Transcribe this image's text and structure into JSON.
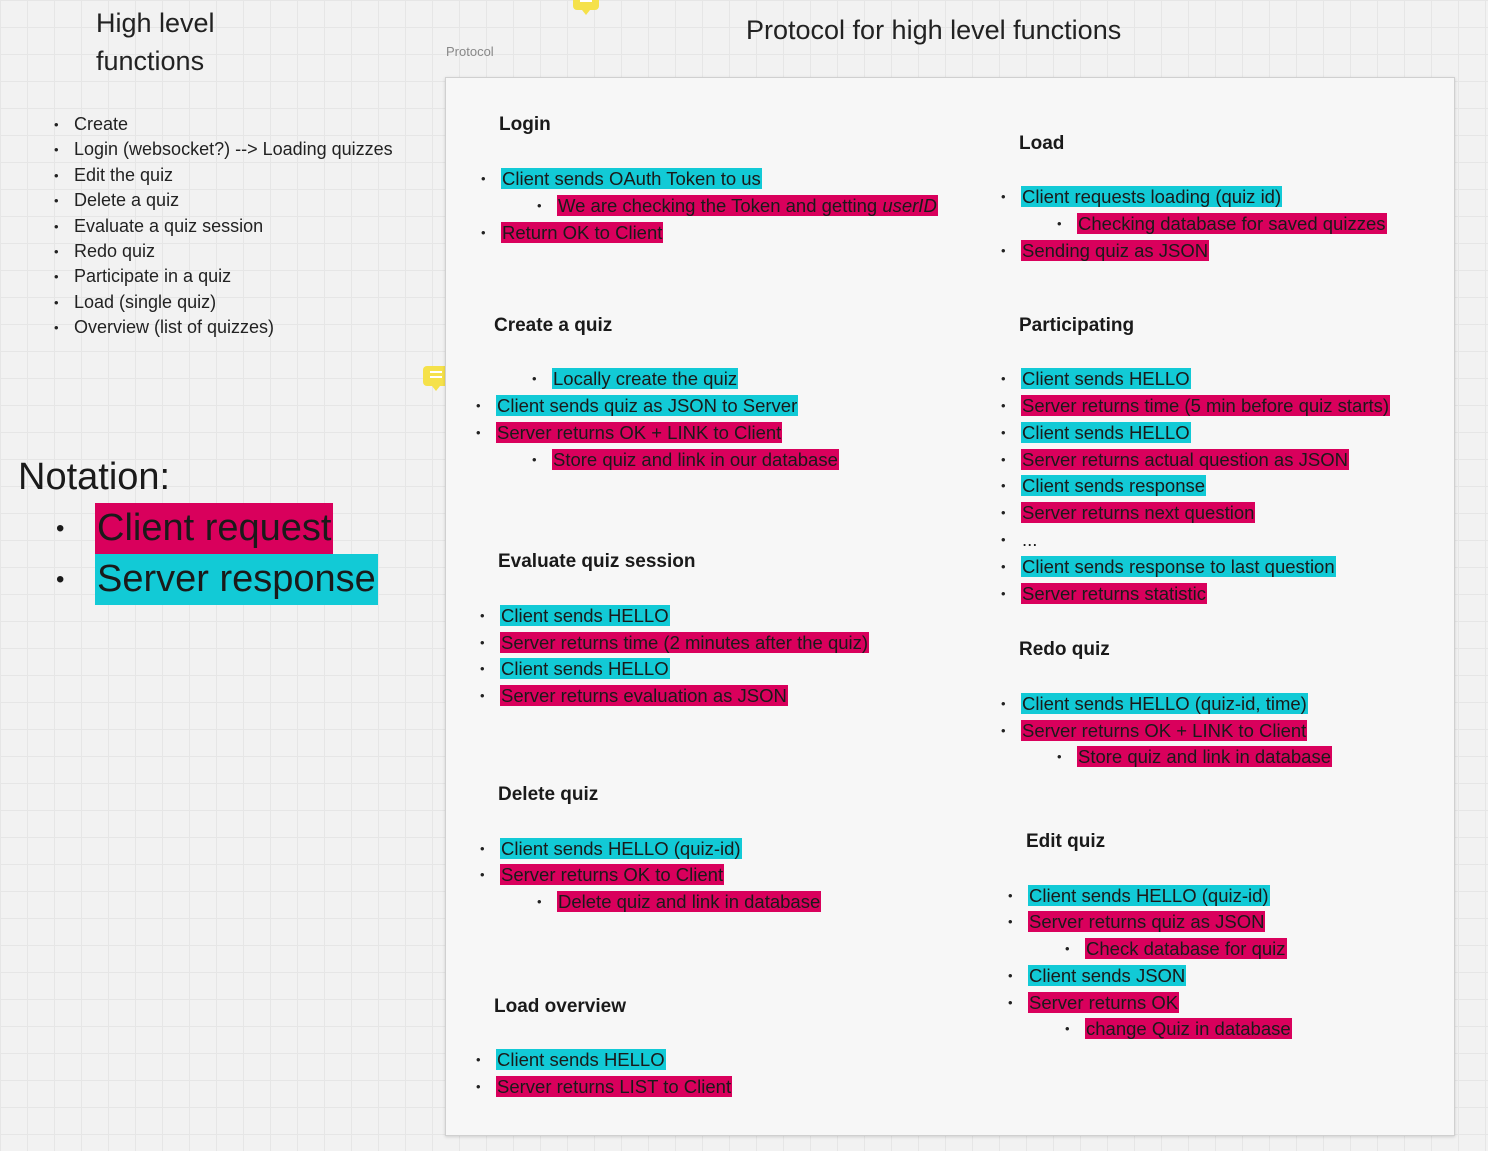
{
  "high_level": {
    "title_line1": "High level",
    "title_line2": "functions",
    "items": [
      "Create",
      "Login (websocket?) --> Loading quizzes",
      "Edit the quiz",
      "Delete a quiz",
      "Evaluate a quiz session",
      "Redo quiz",
      "Participate in a quiz",
      "Load (single quiz)",
      "Overview (list of quizzes)"
    ]
  },
  "notation": {
    "title": "Notation:",
    "client_request": "Client request",
    "server_response": "Server response"
  },
  "protocol": {
    "frame_label": "Protocol",
    "title": "Protocol for high level functions",
    "sections": {
      "login": {
        "title": "Login",
        "lines": [
          "Client sends OAuth Token to us",
          "We are checking the Token and getting ",
          "userID",
          "Return OK to Client"
        ]
      },
      "load": {
        "title": "Load",
        "lines": [
          "Client requests loading (quiz id)",
          "Checking database for saved quizzes",
          "Sending quiz as JSON"
        ]
      },
      "create": {
        "title": "Create a quiz",
        "lines": [
          "Locally create the quiz",
          "Client sends quiz as JSON to Server",
          "Server returns OK + LINK to Client",
          "Store quiz and link in our database"
        ]
      },
      "participating": {
        "title": "Participating",
        "lines": [
          "Client sends HELLO",
          "Server returns time (5 min before quiz starts)",
          "Client sends HELLO",
          "Server returns actual question as JSON",
          "Client sends response",
          "Server returns next question",
          "...",
          "Client sends response to last question",
          "Server returns statistic"
        ]
      },
      "evaluate": {
        "title": "Evaluate quiz session",
        "lines": [
          "Client sends HELLO",
          "Server returns time (2 minutes after the quiz)",
          "Client sends HELLO",
          "Server returns evaluation as JSON"
        ]
      },
      "redo": {
        "title": "Redo quiz",
        "lines": [
          "Client sends HELLO (quiz-id, time)",
          "Server returns OK + LINK to Client",
          "Store quiz and link in database"
        ]
      },
      "delete": {
        "title": "Delete quiz",
        "lines": [
          "Client sends HELLO (quiz-id)",
          "Server returns OK to Client",
          "Delete quiz and link in database"
        ]
      },
      "edit": {
        "title": "Edit quiz",
        "lines": [
          "Client sends HELLO (quiz-id)",
          "Server returns quiz as JSON",
          "Check database for quiz",
          "Client sends JSON",
          "Server returns OK",
          "change Quiz in database"
        ]
      },
      "overview": {
        "title": "Load overview",
        "lines": [
          "Client sends HELLO",
          "Server returns LIST to Client"
        ]
      }
    }
  },
  "colors": {
    "cyan": "#12cad6",
    "pink": "#d9005c",
    "note": "#f5e14a"
  },
  "icons": [
    "comment-note-icon"
  ]
}
